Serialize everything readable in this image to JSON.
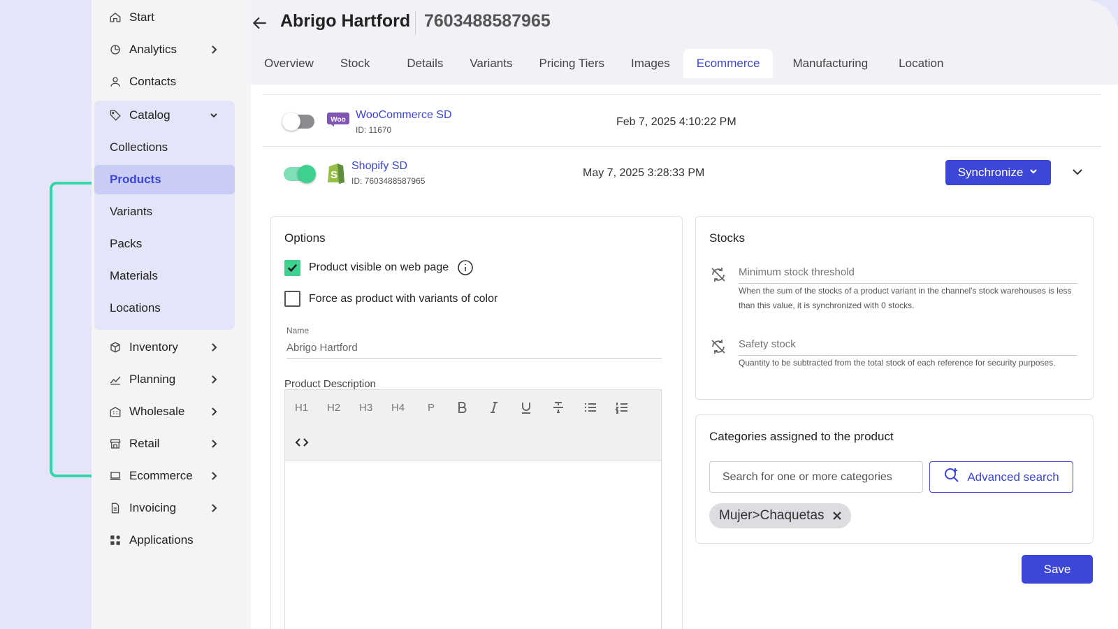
{
  "sidebar": {
    "items": [
      {
        "label": "Start",
        "icon": "home-icon"
      },
      {
        "label": "Analytics",
        "icon": "analytics-icon"
      },
      {
        "label": "Contacts",
        "icon": "person-icon"
      },
      {
        "label": "Catalog",
        "icon": "tag-icon"
      },
      {
        "label": "Inventory",
        "icon": "box-icon"
      },
      {
        "label": "Planning",
        "icon": "trend-icon"
      },
      {
        "label": "Wholesale",
        "icon": "building-icon"
      },
      {
        "label": "Retail",
        "icon": "store-icon"
      },
      {
        "label": "Ecommerce",
        "icon": "laptop-icon"
      },
      {
        "label": "Invoicing",
        "icon": "document-icon"
      },
      {
        "label": "Applications",
        "icon": "apps-icon"
      }
    ],
    "catalog_sub": [
      "Collections",
      "Products",
      "Variants",
      "Packs",
      "Materials",
      "Locations"
    ]
  },
  "header": {
    "title": "Abrigo Hartford",
    "code": "7603488587965"
  },
  "tabs": [
    "Overview",
    "Stock",
    "Details",
    "Variants",
    "Pricing Tiers",
    "Images",
    "Ecommerce",
    "Manufacturing",
    "Location"
  ],
  "channels": [
    {
      "name": "WooCommerce SD",
      "id": "ID: 11670",
      "date": "Feb 7, 2025 4:10:22 PM",
      "enabled": false
    },
    {
      "name": "Shopify SD",
      "id": "ID: 7603488587965",
      "date": "May 7, 2025 3:28:33 PM",
      "enabled": true
    }
  ],
  "sync_label": "Synchronize",
  "options": {
    "title": "Options",
    "visible_label": "Product visible on web page",
    "visible_checked": true,
    "force_variants_label": "Force as product with variants of color",
    "force_variants_checked": false,
    "name_label": "Name",
    "name_value": "Abrigo Hartford",
    "description_label": "Product Description",
    "toolbar": [
      "H1",
      "H2",
      "H3",
      "H4",
      "P"
    ]
  },
  "stocks": {
    "title": "Stocks",
    "min_placeholder": "Minimum stock threshold",
    "min_help": "When the sum of the stocks of a product variant in the channel's stock warehouses is less than this value, it is synchronized with 0 stocks.",
    "safety_placeholder": "Safety stock",
    "safety_help": "Quantity to be subtracted from the total stock of each reference for security purposes."
  },
  "categories": {
    "title": "Categories assigned to the product",
    "search_placeholder": "Search for one or more categories",
    "advanced_label": "Advanced search",
    "chips": [
      "Mujer>Chaquetas"
    ]
  },
  "save_label": "Save",
  "colors": {
    "accent": "#3c46d8",
    "success": "#3fcf8e",
    "bracket": "#34d6a8"
  }
}
